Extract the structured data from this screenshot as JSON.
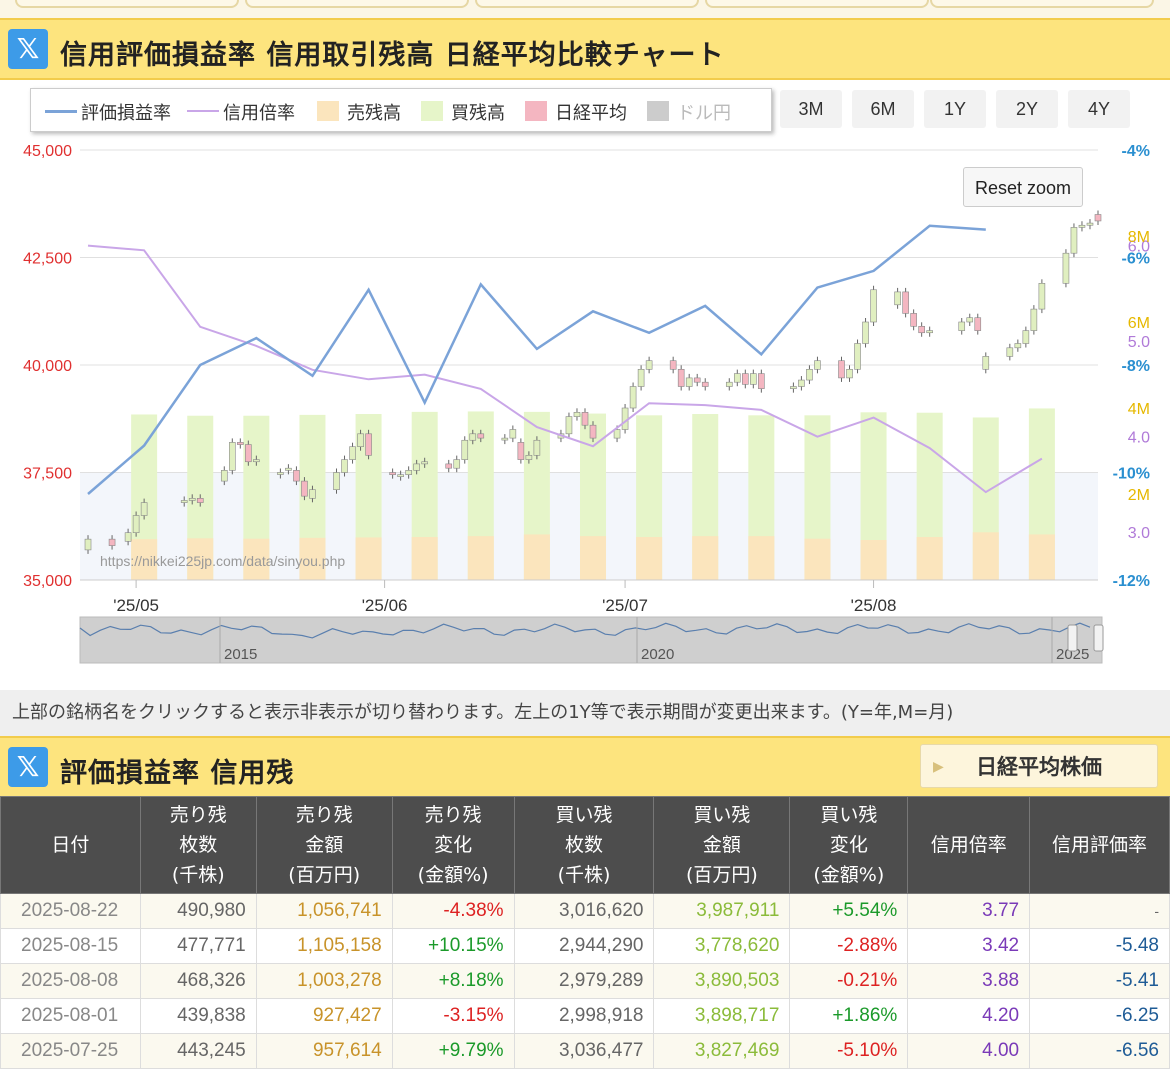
{
  "section1": {
    "title": "信用評価損益率 信用取引残高 日経平均比較チャート"
  },
  "section2": {
    "title": "評価損益率 信用残"
  },
  "x_logo": "𝕏",
  "legend": [
    {
      "label": "評価損益率",
      "kind": "line",
      "color": "#7ba3d8",
      "visible": true
    },
    {
      "label": "信用倍率",
      "kind": "line",
      "color": "#c9a6e8",
      "visible": true
    },
    {
      "label": "売残高",
      "kind": "box",
      "color": "#fbe5bd",
      "visible": true
    },
    {
      "label": "買残高",
      "kind": "box",
      "color": "#e6f5c9",
      "visible": true
    },
    {
      "label": "日経平均",
      "kind": "box",
      "color": "#f4b6c1",
      "visible": true
    },
    {
      "label": "ドル円",
      "kind": "box",
      "color": "#cccccc",
      "visible": false
    }
  ],
  "range_buttons": [
    "3M",
    "6M",
    "1Y",
    "2Y",
    "4Y"
  ],
  "reset_zoom": "Reset zoom",
  "watermark": "https://nikkei225jp.com/data/sinyou.php",
  "navigator_labels": [
    "2015",
    "2020",
    "2025"
  ],
  "note": "上部の銘柄名をクリックすると表示非表示が切り替わります。左上の1Y等で表示期間が変更出来ます。(Y=年,M=月)",
  "nikkei_button": "日経平均株価",
  "colors": {
    "accent_yellow": "#fde47e",
    "header_dark": "#4d4d4d",
    "pos": "#1b9a2a",
    "neg": "#dd2222"
  },
  "chart_data": {
    "type": "line",
    "x_range": [
      "2025-04-24",
      "2025-08-29"
    ],
    "x_ticks": [
      {
        "date": "2025-05-01",
        "label": "'25/05"
      },
      {
        "date": "2025-06-01",
        "label": "'25/06"
      },
      {
        "date": "2025-07-01",
        "label": "'25/07"
      },
      {
        "date": "2025-08-01",
        "label": "'25/08"
      }
    ],
    "axes": {
      "nikkei": {
        "min": 35000,
        "max": 45000,
        "ticks": [
          35000,
          37500,
          40000,
          42500,
          45000
        ],
        "tick_labels": [
          "35,000",
          "37,500",
          "40,000",
          "42,500",
          "45,000"
        ],
        "color": "#e03030"
      },
      "pl_rate": {
        "min": -12,
        "max": -4,
        "ticks": [
          -12,
          -10,
          -8,
          -6,
          -4
        ],
        "tick_labels": [
          "-12%",
          "-10%",
          "-8%",
          "-6%",
          "-4%"
        ],
        "color": "#2a8fd0"
      },
      "ratio": {
        "min": 2.5,
        "max": 7.0,
        "ticks": [
          3.0,
          4.0,
          5.0,
          6.0
        ],
        "tick_labels": [
          "3.0",
          "4.0",
          "5.0",
          "6.0"
        ],
        "color": "#b07ad8"
      },
      "balance": {
        "min": 0,
        "max": 10,
        "ticks": [
          2,
          4,
          6,
          8
        ],
        "tick_labels": [
          "2M",
          "4M",
          "6M",
          "8M"
        ],
        "color": "#e6b800"
      }
    },
    "grid": true,
    "series": [
      {
        "name": "評価損益率",
        "axis": "pl_rate",
        "color": "#7ba3d8",
        "points": [
          [
            "2025-04-25",
            -10.4
          ],
          [
            "2025-05-02",
            -9.5
          ],
          [
            "2025-05-09",
            -8.0
          ],
          [
            "2025-05-16",
            -7.5
          ],
          [
            "2025-05-23",
            -8.2
          ],
          [
            "2025-05-30",
            -6.6
          ],
          [
            "2025-06-06",
            -8.7
          ],
          [
            "2025-06-13",
            -6.5
          ],
          [
            "2025-06-20",
            -7.7
          ],
          [
            "2025-06-27",
            -7.0
          ],
          [
            "2025-07-04",
            -7.4
          ],
          [
            "2025-07-11",
            -6.9
          ],
          [
            "2025-07-18",
            -7.8
          ],
          [
            "2025-07-25",
            -6.56
          ],
          [
            "2025-08-01",
            -6.25
          ],
          [
            "2025-08-08",
            -5.41
          ],
          [
            "2025-08-15",
            -5.48
          ]
        ]
      },
      {
        "name": "信用倍率",
        "axis": "ratio",
        "color": "#c9a6e8",
        "points": [
          [
            "2025-04-25",
            6.0
          ],
          [
            "2025-05-02",
            5.95
          ],
          [
            "2025-05-09",
            5.15
          ],
          [
            "2025-05-16",
            4.95
          ],
          [
            "2025-05-23",
            4.7
          ],
          [
            "2025-05-30",
            4.6
          ],
          [
            "2025-06-06",
            4.65
          ],
          [
            "2025-06-13",
            4.5
          ],
          [
            "2025-06-20",
            4.1
          ],
          [
            "2025-06-27",
            3.9
          ],
          [
            "2025-07-04",
            4.35
          ],
          [
            "2025-07-11",
            4.33
          ],
          [
            "2025-07-18",
            4.28
          ],
          [
            "2025-07-25",
            4.0
          ],
          [
            "2025-08-01",
            4.2
          ],
          [
            "2025-08-08",
            3.88
          ],
          [
            "2025-08-15",
            3.42
          ],
          [
            "2025-08-22",
            3.77
          ]
        ]
      },
      {
        "name": "買残高",
        "axis": "balance",
        "kind": "bar",
        "color": "#e6f5c9",
        "points": [
          [
            "2025-05-02",
            3.85
          ],
          [
            "2025-05-09",
            3.82
          ],
          [
            "2025-05-16",
            3.82
          ],
          [
            "2025-05-23",
            3.84
          ],
          [
            "2025-05-30",
            3.86
          ],
          [
            "2025-06-06",
            3.91
          ],
          [
            "2025-06-13",
            3.92
          ],
          [
            "2025-06-20",
            3.91
          ],
          [
            "2025-06-27",
            3.87
          ],
          [
            "2025-07-04",
            3.83
          ],
          [
            "2025-07-11",
            3.86
          ],
          [
            "2025-07-18",
            3.83
          ],
          [
            "2025-07-25",
            3.83
          ],
          [
            "2025-08-01",
            3.9
          ],
          [
            "2025-08-08",
            3.89
          ],
          [
            "2025-08-15",
            3.78
          ],
          [
            "2025-08-22",
            3.99
          ]
        ]
      },
      {
        "name": "売残高",
        "axis": "balance",
        "kind": "bar",
        "color": "#fbe5bd",
        "points": [
          [
            "2025-05-02",
            0.95
          ],
          [
            "2025-05-09",
            0.97
          ],
          [
            "2025-05-16",
            0.96
          ],
          [
            "2025-05-23",
            0.98
          ],
          [
            "2025-05-30",
            0.99
          ],
          [
            "2025-06-06",
            1.0
          ],
          [
            "2025-06-13",
            1.02
          ],
          [
            "2025-06-20",
            1.06
          ],
          [
            "2025-06-27",
            1.02
          ],
          [
            "2025-07-04",
            1.0
          ],
          [
            "2025-07-11",
            1.02
          ],
          [
            "2025-07-18",
            1.02
          ],
          [
            "2025-07-25",
            0.96
          ],
          [
            "2025-08-01",
            0.93
          ],
          [
            "2025-08-08",
            1.0
          ],
          [
            "2025-08-15",
            1.11
          ],
          [
            "2025-08-22",
            1.06
          ]
        ]
      },
      {
        "name": "日経平均",
        "axis": "nikkei",
        "kind": "candlestick",
        "up_color": "#e0efc0",
        "down_color": "#f4b6c1",
        "candles": [
          [
            "2025-04-25",
            35700,
            35950
          ],
          [
            "2025-04-28",
            35950,
            35800
          ],
          [
            "2025-04-30",
            35900,
            36100
          ],
          [
            "2025-05-01",
            36100,
            36500
          ],
          [
            "2025-05-02",
            36500,
            36800
          ],
          [
            "2025-05-07",
            36800,
            36850
          ],
          [
            "2025-05-08",
            36850,
            36900
          ],
          [
            "2025-05-09",
            36900,
            36800
          ],
          [
            "2025-05-12",
            37300,
            37550
          ],
          [
            "2025-05-13",
            37550,
            38200
          ],
          [
            "2025-05-14",
            38200,
            38150
          ],
          [
            "2025-05-15",
            38150,
            37750
          ],
          [
            "2025-05-16",
            37750,
            37800
          ],
          [
            "2025-05-19",
            37500,
            37500
          ],
          [
            "2025-05-20",
            37550,
            37600
          ],
          [
            "2025-05-21",
            37550,
            37300
          ],
          [
            "2025-05-22",
            37300,
            36950
          ],
          [
            "2025-05-23",
            36900,
            37100
          ],
          [
            "2025-05-26",
            37100,
            37500
          ],
          [
            "2025-05-27",
            37500,
            37800
          ],
          [
            "2025-05-28",
            37800,
            38100
          ],
          [
            "2025-05-29",
            38100,
            38400
          ],
          [
            "2025-05-30",
            38400,
            37900
          ],
          [
            "2025-06-02",
            37500,
            37450
          ],
          [
            "2025-06-03",
            37450,
            37450
          ],
          [
            "2025-06-04",
            37450,
            37550
          ],
          [
            "2025-06-05",
            37550,
            37700
          ],
          [
            "2025-06-06",
            37700,
            37750
          ],
          [
            "2025-06-09",
            37700,
            37600
          ],
          [
            "2025-06-10",
            37600,
            37800
          ],
          [
            "2025-06-11",
            37800,
            38250
          ],
          [
            "2025-06-12",
            38250,
            38400
          ],
          [
            "2025-06-13",
            38400,
            38300
          ],
          [
            "2025-06-16",
            38300,
            38300
          ],
          [
            "2025-06-17",
            38300,
            38500
          ],
          [
            "2025-06-18",
            38200,
            37800
          ],
          [
            "2025-06-19",
            37800,
            37900
          ],
          [
            "2025-06-20",
            37900,
            38250
          ],
          [
            "2025-06-23",
            38300,
            38400
          ],
          [
            "2025-06-24",
            38400,
            38800
          ],
          [
            "2025-06-25",
            38800,
            38900
          ],
          [
            "2025-06-26",
            38900,
            38600
          ],
          [
            "2025-06-27",
            38600,
            38300
          ],
          [
            "2025-06-30",
            38300,
            38500
          ],
          [
            "2025-07-01",
            38500,
            39000
          ],
          [
            "2025-07-02",
            39000,
            39500
          ],
          [
            "2025-07-03",
            39500,
            39900
          ],
          [
            "2025-07-04",
            39900,
            40100
          ],
          [
            "2025-07-07",
            40100,
            39900
          ],
          [
            "2025-07-08",
            39900,
            39500
          ],
          [
            "2025-07-09",
            39500,
            39700
          ],
          [
            "2025-07-10",
            39700,
            39600
          ],
          [
            "2025-07-11",
            39600,
            39500
          ],
          [
            "2025-07-14",
            39500,
            39600
          ],
          [
            "2025-07-15",
            39600,
            39800
          ],
          [
            "2025-07-16",
            39800,
            39550
          ],
          [
            "2025-07-17",
            39550,
            39800
          ],
          [
            "2025-07-18",
            39800,
            39450
          ],
          [
            "2025-07-22",
            39450,
            39500
          ],
          [
            "2025-07-23",
            39500,
            39650
          ],
          [
            "2025-07-24",
            39650,
            39900
          ],
          [
            "2025-07-25",
            39900,
            40100
          ],
          [
            "2025-07-28",
            40100,
            39700
          ],
          [
            "2025-07-29",
            39700,
            39900
          ],
          [
            "2025-07-30",
            39900,
            40500
          ],
          [
            "2025-07-31",
            40500,
            41000
          ],
          [
            "2025-08-01",
            41000,
            41750
          ],
          [
            "2025-08-04",
            41400,
            41700
          ],
          [
            "2025-08-05",
            41700,
            41200
          ],
          [
            "2025-08-06",
            41200,
            40900
          ],
          [
            "2025-08-07",
            40900,
            40750
          ],
          [
            "2025-08-08",
            40750,
            40800
          ],
          [
            "2025-08-12",
            40800,
            41000
          ],
          [
            "2025-08-13",
            41000,
            41100
          ],
          [
            "2025-08-14",
            41100,
            40800
          ],
          [
            "2025-08-15",
            39900,
            40200
          ],
          [
            "2025-08-18",
            40200,
            40400
          ],
          [
            "2025-08-19",
            40400,
            40500
          ],
          [
            "2025-08-20",
            40500,
            40800
          ],
          [
            "2025-08-21",
            40800,
            41300
          ],
          [
            "2025-08-22",
            41300,
            41900
          ],
          [
            "2025-08-25",
            41900,
            42600
          ],
          [
            "2025-08-26",
            42600,
            43200
          ],
          [
            "2025-08-27",
            43200,
            43250
          ],
          [
            "2025-08-28",
            43250,
            43300
          ],
          [
            "2025-08-29",
            43500,
            43350
          ]
        ]
      }
    ]
  },
  "table": {
    "headers": [
      [
        "日付"
      ],
      [
        "売り残",
        "枚数",
        "(千株)"
      ],
      [
        "売り残",
        "金額",
        "(百万円)"
      ],
      [
        "売り残",
        "変化",
        "(金額%)"
      ],
      [
        "買い残",
        "枚数",
        "(千株)"
      ],
      [
        "買い残",
        "金額",
        "(百万円)"
      ],
      [
        "買い残",
        "変化",
        "(金額%)"
      ],
      [
        "信用倍率"
      ],
      [
        "信用評価率"
      ]
    ],
    "rows": [
      [
        "2025-08-22",
        "490,980",
        "1,056,741",
        "-4.38%",
        "3,016,620",
        "3,987,911",
        "+5.54%",
        "3.77",
        "-"
      ],
      [
        "2025-08-15",
        "477,771",
        "1,105,158",
        "+10.15%",
        "2,944,290",
        "3,778,620",
        "-2.88%",
        "3.42",
        "-5.48"
      ],
      [
        "2025-08-08",
        "468,326",
        "1,003,278",
        "+8.18%",
        "2,979,289",
        "3,890,503",
        "-0.21%",
        "3.88",
        "-5.41"
      ],
      [
        "2025-08-01",
        "439,838",
        "927,427",
        "-3.15%",
        "2,998,918",
        "3,898,717",
        "+1.86%",
        "4.20",
        "-6.25"
      ],
      [
        "2025-07-25",
        "443,245",
        "957,614",
        "+9.79%",
        "3,036,477",
        "3,827,469",
        "-5.10%",
        "4.00",
        "-6.56"
      ]
    ]
  }
}
